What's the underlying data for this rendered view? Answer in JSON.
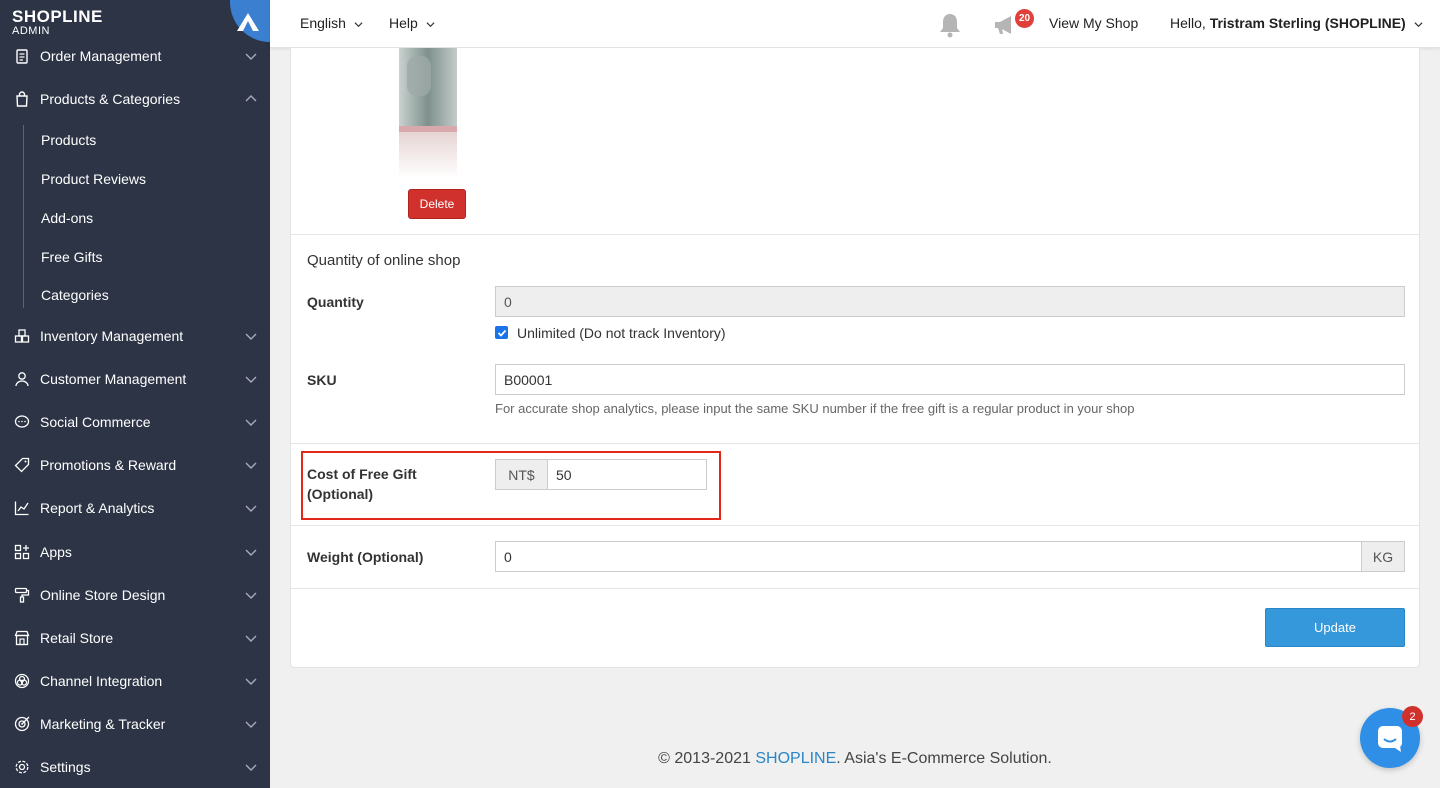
{
  "brand": {
    "name": "SHOPLINE",
    "sub": "ADMIN"
  },
  "sidebar": {
    "items": [
      {
        "label": "Order Management",
        "icon": "clipboard-icon"
      },
      {
        "label": "Products & Categories",
        "icon": "shopping-bag-icon",
        "expanded": true
      },
      {
        "label": "Inventory Management",
        "icon": "boxes-icon"
      },
      {
        "label": "Customer Management",
        "icon": "user-icon"
      },
      {
        "label": "Social Commerce",
        "icon": "chat-bubble-icon"
      },
      {
        "label": "Promotions & Reward",
        "icon": "tag-icon"
      },
      {
        "label": "Report & Analytics",
        "icon": "chart-icon"
      },
      {
        "label": "Apps",
        "icon": "apps-grid-icon"
      },
      {
        "label": "Online Store Design",
        "icon": "paint-roller-icon"
      },
      {
        "label": "Retail Store",
        "icon": "store-icon"
      },
      {
        "label": "Channel Integration",
        "icon": "channels-icon"
      },
      {
        "label": "Marketing & Tracker",
        "icon": "target-icon"
      },
      {
        "label": "Settings",
        "icon": "gear-icon"
      }
    ],
    "subitems": [
      "Products",
      "Product Reviews",
      "Add-ons",
      "Free Gifts",
      "Categories"
    ]
  },
  "topbar": {
    "language": "English",
    "help": "Help",
    "notification_count": "20",
    "view_shop": "View My Shop",
    "greeting": "Hello,",
    "user": "Tristram Sterling (SHOPLINE)"
  },
  "form": {
    "delete_label": "Delete",
    "section_title": "Quantity of online shop",
    "quantity_label": "Quantity",
    "quantity_value": "0",
    "unlimited_label": "Unlimited (Do not track Inventory)",
    "unlimited_checked": true,
    "sku_label": "SKU",
    "sku_value": "B00001",
    "sku_help": "For accurate shop analytics, please input the same SKU number if the free gift is a regular product in your shop",
    "cost_label": "Cost of Free Gift (Optional)",
    "currency": "NT$",
    "cost_value": "50",
    "weight_label": "Weight (Optional)",
    "weight_value": "0",
    "weight_unit": "KG",
    "update_label": "Update"
  },
  "footer": {
    "copyright": "© 2013-2021",
    "brand": "SHOPLINE",
    "tagline": ". Asia's E-Commerce Solution."
  },
  "chat": {
    "badge": "2"
  },
  "colors": {
    "sidebar_bg": "#2c3445",
    "accent": "#3498db",
    "danger": "#d0312d",
    "highlight": "#e2271b"
  }
}
